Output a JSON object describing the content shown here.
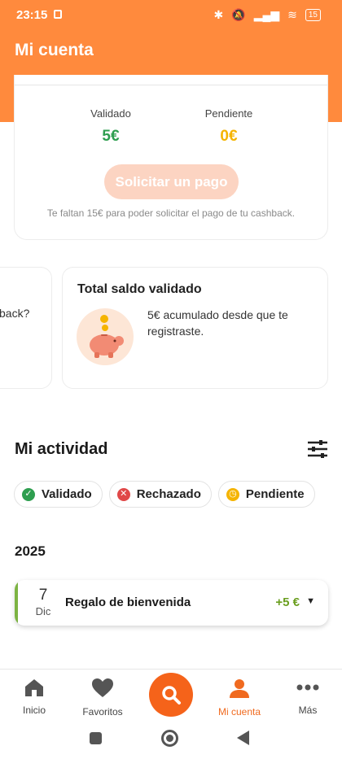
{
  "status_bar": {
    "time": "23:15",
    "battery": "15"
  },
  "header": {
    "title": "Mi cuenta"
  },
  "balance": {
    "validated_label": "Validado",
    "validated_value": "5€",
    "pending_label": "Pendiente",
    "pending_value": "0€",
    "pay_button": "Solicitar un pago",
    "hint": "Te faltan 15€ para poder solicitar el pago de tu cashback."
  },
  "info_cards": {
    "left_partial_text": "back?",
    "total": {
      "title": "Total saldo validado",
      "text": "5€ acumulado desde que te registraste."
    }
  },
  "activity": {
    "title": "Mi actividad",
    "filters": [
      {
        "label": "Validado",
        "icon": "check-icon",
        "color": "#2e9e4f"
      },
      {
        "label": "Rechazado",
        "icon": "cross-icon",
        "color": "#e04848"
      },
      {
        "label": "Pendiente",
        "icon": "clock-icon",
        "color": "#f5b400"
      }
    ],
    "year": "2025",
    "items": [
      {
        "day": "7",
        "month": "Dic",
        "name": "Regalo de bienvenida",
        "amount": "+5 €"
      }
    ]
  },
  "bottom_nav": [
    {
      "label": "Inicio",
      "icon": "home-icon"
    },
    {
      "label": "Favoritos",
      "icon": "heart-icon"
    },
    {
      "label": "",
      "icon": "search-icon"
    },
    {
      "label": "Mi cuenta",
      "icon": "user-icon"
    },
    {
      "label": "Más",
      "icon": "more-icon"
    }
  ],
  "colors": {
    "brand": "#ff8a3d",
    "validated": "#2e9e4f",
    "pending": "#f5b400",
    "amount": "#6a9e1f",
    "active_nav": "#f06a1f"
  }
}
